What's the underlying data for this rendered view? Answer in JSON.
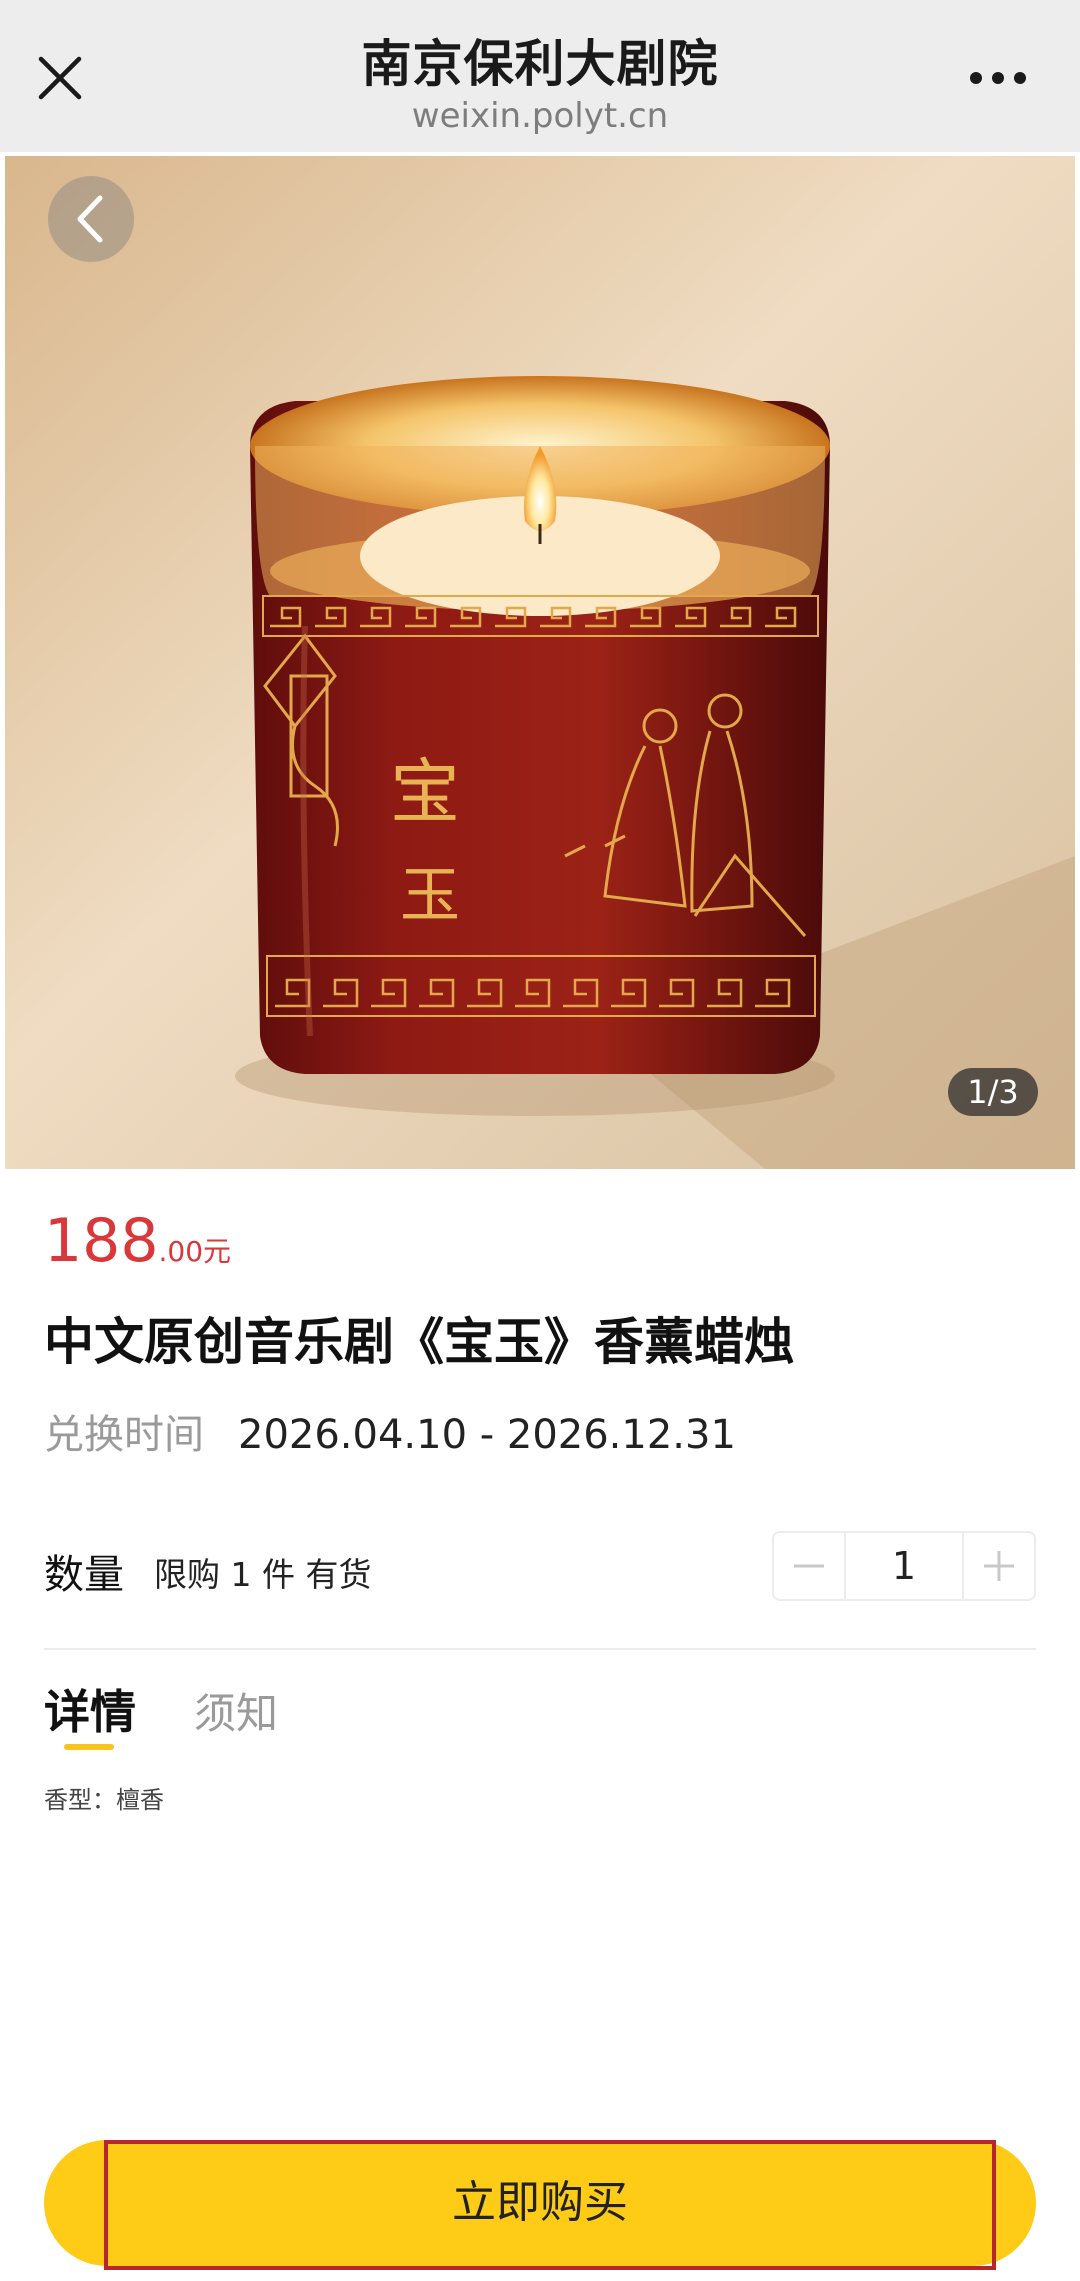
{
  "header": {
    "title": "南京保利大剧院",
    "domain": "weixin.polyt.cn",
    "close_icon": "close-icon",
    "more_icon": "more-dots-icon"
  },
  "gallery": {
    "back_icon": "chevron-left-icon",
    "pager": "1/3",
    "current_index": 1,
    "total_images": 3
  },
  "product": {
    "price_integer": "188",
    "price_decimal": ".00元",
    "title": "中文原创音乐剧《宝玉》香薰蜡烛",
    "redeem_label": "兑换时间",
    "redeem_range": "2026.04.10 - 2026.12.31"
  },
  "quantity": {
    "label": "数量",
    "limit_text": "限购 1 件 有货",
    "value": "1",
    "minus_icon": "minus-icon",
    "plus_icon": "plus-icon"
  },
  "tabs": [
    {
      "label": "详情",
      "active": true
    },
    {
      "label": "须知",
      "active": false
    }
  ],
  "detail": {
    "text": "香型：檀香"
  },
  "footer": {
    "buy_label": "立即购买"
  },
  "colors": {
    "price": "#d9373a",
    "accent_yellow": "#fecb16",
    "tab_underline": "#f6c41c",
    "highlight_border": "#b5272c",
    "header_bg": "#ededed"
  }
}
